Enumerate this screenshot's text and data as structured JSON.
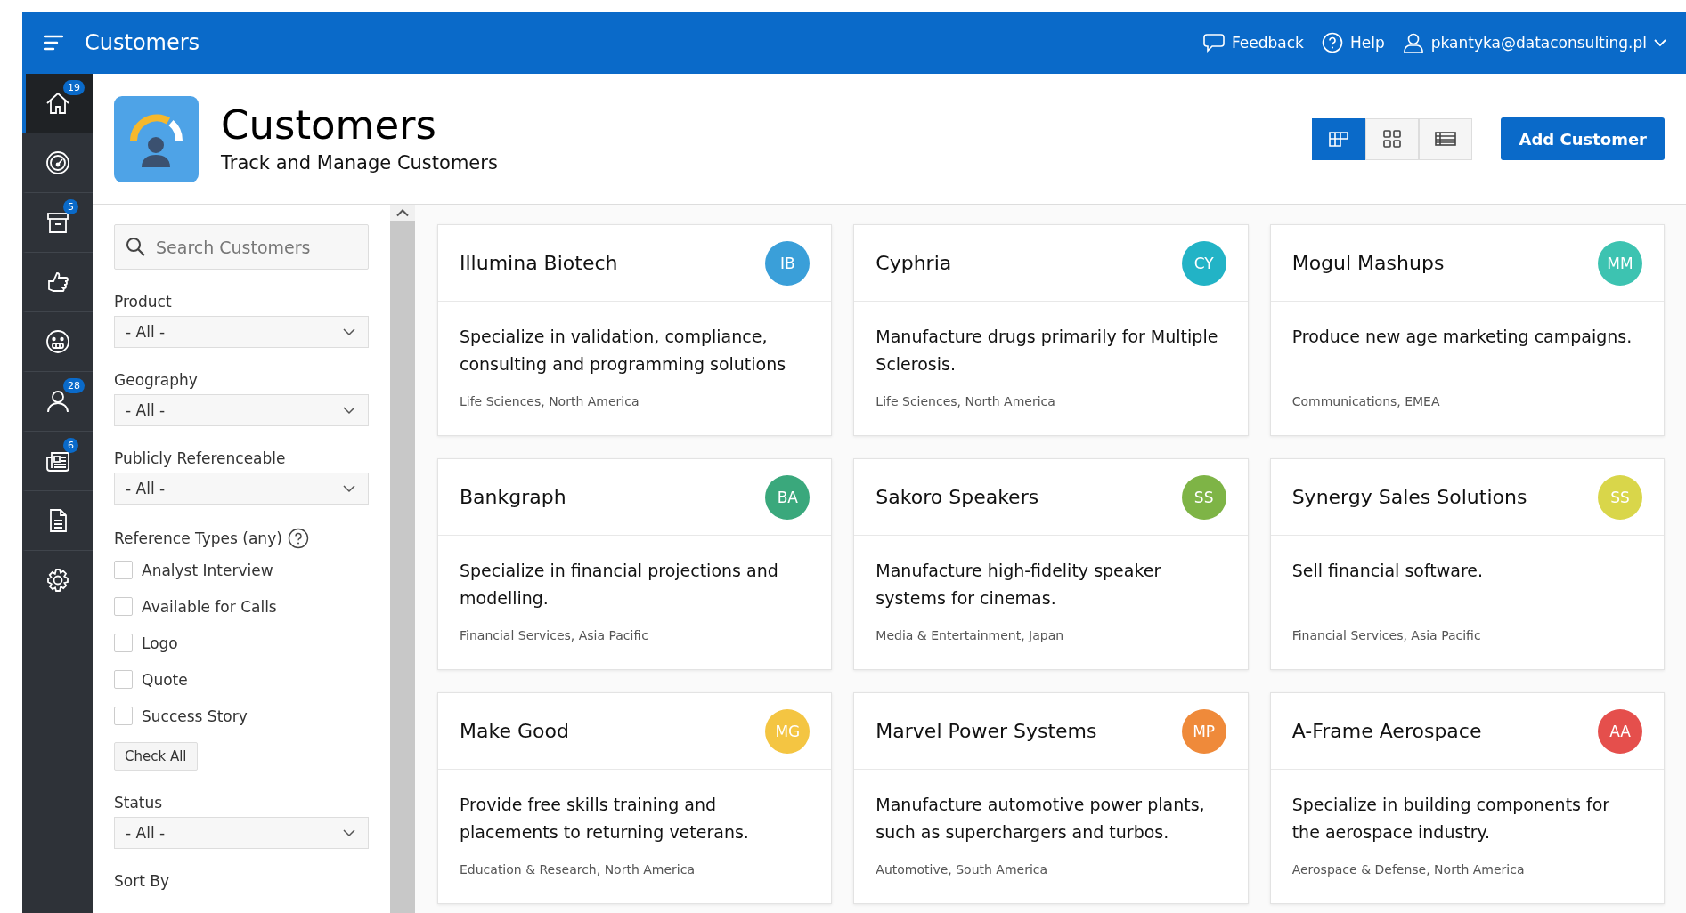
{
  "topbar": {
    "title": "Customers",
    "links": [
      {
        "kind": "feedback",
        "label": "Feedback"
      },
      {
        "kind": "help",
        "label": "Help"
      }
    ],
    "user": {
      "label": "pkantyka@dataconsulting.pl"
    }
  },
  "nav": [
    {
      "kind": "home",
      "badge": "19",
      "selected": true
    },
    {
      "kind": "gauge",
      "selected": false
    },
    {
      "kind": "archive",
      "badge": "5",
      "selected": false
    },
    {
      "kind": "thumb",
      "selected": false
    },
    {
      "kind": "face",
      "selected": false
    },
    {
      "kind": "user",
      "badge": "28",
      "selected": false
    },
    {
      "kind": "news",
      "badge": "6",
      "selected": false
    },
    {
      "kind": "doc",
      "selected": false
    },
    {
      "kind": "gear",
      "selected": false
    }
  ],
  "header": {
    "title": "Customers",
    "subtitle": "Track and Manage Customers",
    "views": [
      {
        "kind": "cards",
        "selected": true
      },
      {
        "kind": "grid",
        "selected": false
      },
      {
        "kind": "table",
        "selected": false
      }
    ],
    "add_button": "Add Customer"
  },
  "filters": {
    "search": {
      "placeholder": "Search Customers"
    },
    "items": [
      {
        "kind": "select",
        "label": "Product",
        "value": "- All -"
      },
      {
        "kind": "select",
        "label": "Geography",
        "value": "- All -"
      },
      {
        "kind": "select",
        "label": "Publicly Referenceable",
        "value": "- All -"
      },
      {
        "kind": "checks",
        "label": "Reference Types (any)",
        "help_icon": true,
        "options": [
          {
            "label": "Analyst Interview",
            "checked": false
          },
          {
            "label": "Available for Calls",
            "checked": false
          },
          {
            "label": "Logo",
            "checked": false
          },
          {
            "label": "Quote",
            "checked": false
          },
          {
            "label": "Success Story",
            "checked": false
          }
        ],
        "button": "Check All"
      },
      {
        "kind": "select",
        "label": "Status",
        "value": "- All -"
      },
      {
        "kind": "select",
        "label": "Sort By"
      }
    ]
  },
  "cards": [
    {
      "name": "Illumina Biotech",
      "initials": "IB",
      "color": "#3a9fd9",
      "description": "Specialize in validation, compliance, consulting and programming solutions",
      "meta": "Life Sciences, North America"
    },
    {
      "name": "Cyphria",
      "initials": "CY",
      "color": "#22b3c6",
      "description": "Manufacture drugs primarily for Multiple Sclerosis.",
      "meta": "Life Sciences, North America"
    },
    {
      "name": "Mogul Mashups",
      "initials": "MM",
      "color": "#3dc3b1",
      "description": "Produce new age marketing campaigns.",
      "meta": "Communications, EMEA"
    },
    {
      "name": "Bankgraph",
      "initials": "BA",
      "color": "#3aa87c",
      "description": "Specialize in financial projections and modelling.",
      "meta": "Financial Services, Asia Pacific"
    },
    {
      "name": "Sakoro Speakers",
      "initials": "SS",
      "color": "#7eb446",
      "description": "Manufacture high-fidelity speaker systems for cinemas.",
      "meta": "Media & Entertainment, Japan"
    },
    {
      "name": "Synergy Sales Solutions",
      "initials": "SS",
      "color": "#d9d64a",
      "description": "Sell financial software.",
      "meta": "Financial Services, Asia Pacific"
    },
    {
      "name": "Make Good",
      "initials": "MG",
      "color": "#f4c542",
      "description": "Provide free skills training and placements to returning veterans.",
      "meta": "Education & Research, North America"
    },
    {
      "name": "Marvel Power Systems",
      "initials": "MP",
      "color": "#ef8a3a",
      "description": "Manufacture automotive power plants, such as superchargers and turbos.",
      "meta": "Automotive, South America"
    },
    {
      "name": "A-Frame Aerospace",
      "initials": "AA",
      "color": "#e54f4c",
      "description": "Specialize in building components for the aerospace industry.",
      "meta": "Aerospace & Defense, North America"
    }
  ]
}
